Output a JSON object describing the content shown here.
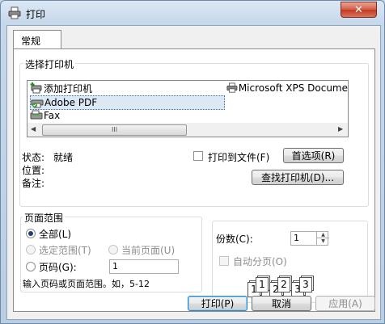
{
  "window": {
    "title": "打印",
    "close_label": "✕"
  },
  "tabs": [
    {
      "label": "常规"
    }
  ],
  "select_printer": {
    "legend": "选择打印机",
    "printers": [
      {
        "label": "添加打印机",
        "icon": "add-printer-icon"
      },
      {
        "label": "Adobe PDF",
        "icon": "pdf-printer-icon",
        "selected": true
      },
      {
        "label": "Fax",
        "icon": "fax-icon"
      },
      {
        "label": "Microsoft XPS Docume",
        "icon": "printer-icon"
      }
    ],
    "scroll_thumb": "III",
    "status_label": "状态:",
    "status_value": "就绪",
    "location_label": "位置:",
    "location_value": "",
    "comment_label": "备注:",
    "comment_value": "",
    "print_to_file_label": "打印到文件(F)",
    "preferences_label": "首选项(R)",
    "find_printer_label": "查找打印机(D)..."
  },
  "page_range": {
    "legend": "页面范围",
    "all_label": "全部(L)",
    "selection_label": "选定范围(T)",
    "current_page_label": "当前页面(U)",
    "pages_label": "页码(G):",
    "pages_value": "1",
    "hint": "输入页码或页面范围。如，5-12"
  },
  "copies": {
    "label": "份数(C):",
    "value": "1",
    "collate_label": "自动分页(O)",
    "collate_pages": [
      "1",
      "1",
      "2",
      "2",
      "3",
      "3"
    ]
  },
  "footer": {
    "print_label": "打印(P)",
    "cancel_label": "取消",
    "apply_label": "应用(A)"
  }
}
